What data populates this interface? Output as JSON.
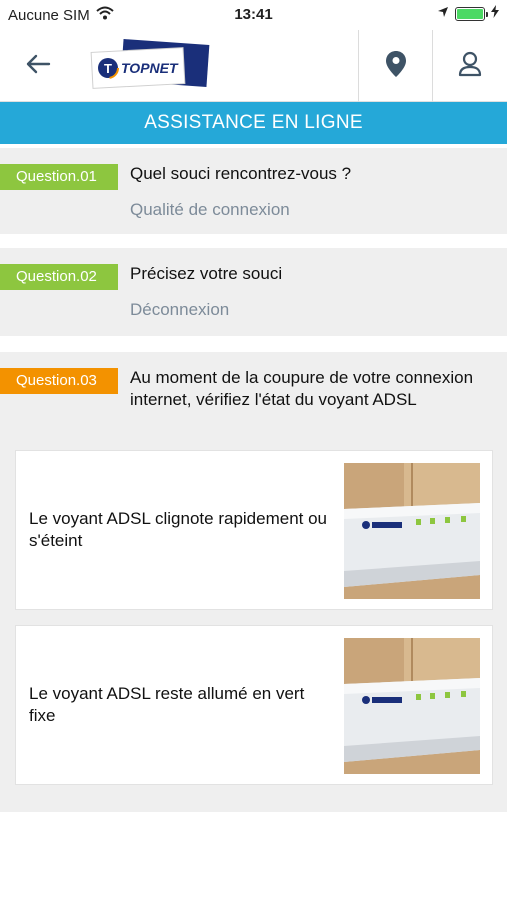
{
  "status": {
    "carrier": "Aucune SIM",
    "time": "13:41"
  },
  "header": {
    "logo_text": "TOPNET"
  },
  "banner": {
    "title": "ASSISTANCE EN LIGNE"
  },
  "questions": [
    {
      "tag": "Question.01",
      "text": "Quel souci rencontrez-vous ?",
      "answer": "Qualité de connexion",
      "tag_color": "#8dc63f"
    },
    {
      "tag": "Question.02",
      "text": "Précisez votre souci",
      "answer": "Déconnexion",
      "tag_color": "#8dc63f"
    },
    {
      "tag": "Question.03",
      "text": "Au moment de la coupure de votre connexion internet, vérifiez l'état du voyant ADSL",
      "tag_color": "#f39200",
      "options": [
        {
          "label": "Le voyant ADSL clignote rapidement ou s'éteint",
          "image": "router-photo"
        },
        {
          "label": "Le voyant ADSL reste allumé en vert fixe",
          "image": "router-photo"
        }
      ]
    }
  ],
  "colors": {
    "banner": "#25a8d8",
    "answer_text": "#7d8b99",
    "background_block": "#efefef"
  }
}
